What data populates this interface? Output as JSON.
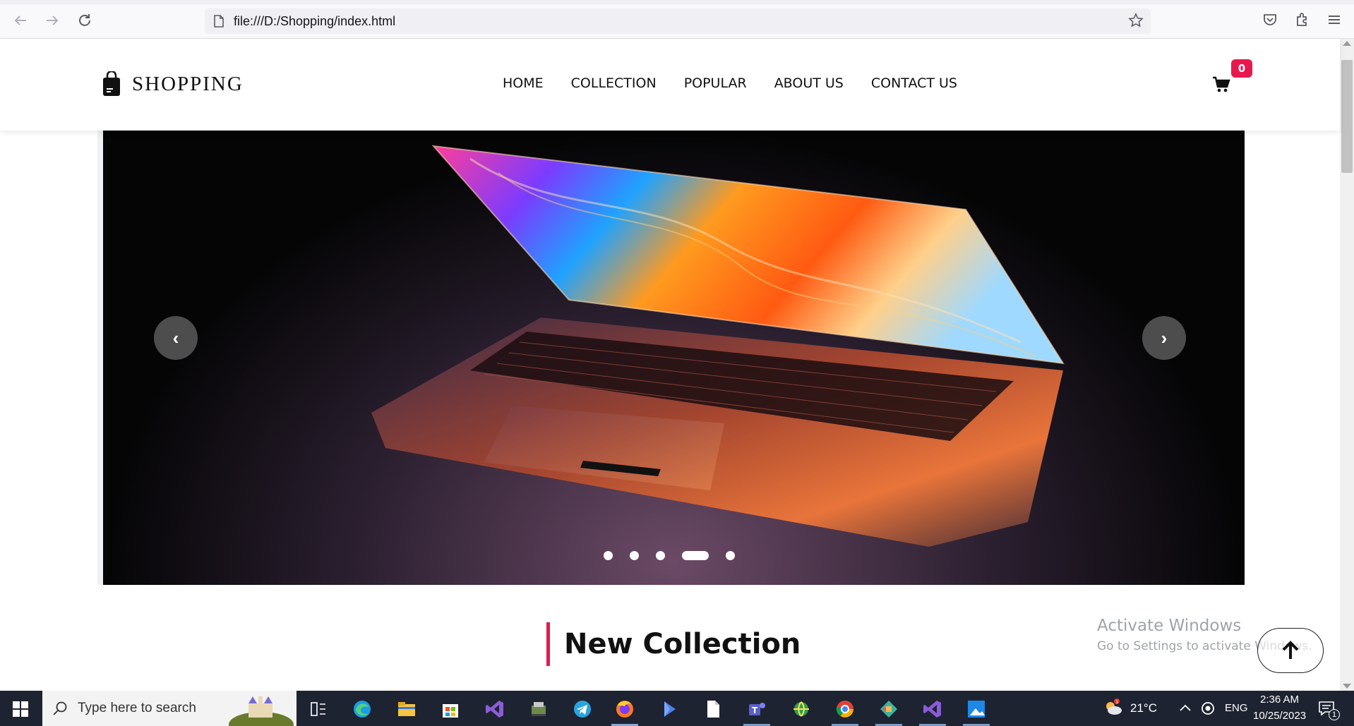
{
  "browser": {
    "url": "file:///D:/Shopping/index.html"
  },
  "header": {
    "logo_text": "SHOPPING",
    "nav": [
      "HOME",
      "COLLECTION",
      "POPULAR",
      "ABOUT US",
      "CONTACT US"
    ],
    "cart_count": "0"
  },
  "carousel": {
    "prev_label": "‹",
    "next_label": "›",
    "slide_count": 5,
    "active_slide": 4
  },
  "section": {
    "title": "New Collection"
  },
  "watermark": {
    "line1": "Activate Windows",
    "line2": "Go to Settings to activate Windows."
  },
  "taskbar": {
    "search_placeholder": "Type here to search",
    "weather": "21°C",
    "language": "ENG",
    "time": "2:36 AM",
    "date": "10/25/2023",
    "notifications": "1"
  },
  "colors": {
    "accent": "#e8184e",
    "taskbar": "#1d2331"
  }
}
